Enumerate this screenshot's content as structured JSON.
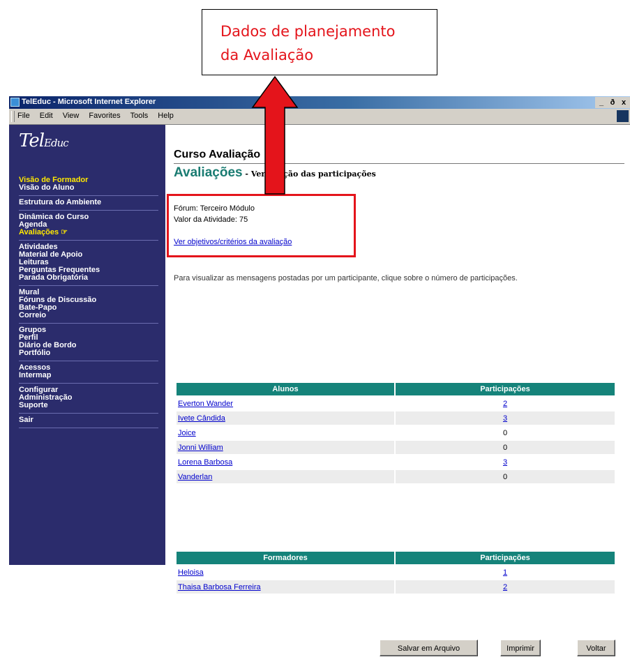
{
  "callout": {
    "line1": "Dados de planejamento",
    "line2": "da Avaliação"
  },
  "window": {
    "title": "TelEduc - Microsoft Internet Explorer",
    "controls": [
      "_",
      "ð",
      "x"
    ],
    "menu": [
      "File",
      "Edit",
      "View",
      "Favorites",
      "Tools",
      "Help"
    ]
  },
  "sidebar": {
    "logo_main": "Tel",
    "logo_sub": "Educ",
    "groups": [
      {
        "items": [
          {
            "label": "Visão de Formador",
            "highlight": true
          },
          {
            "label": "Visão do Aluno",
            "highlight": false
          }
        ]
      },
      {
        "items": [
          {
            "label": "Estrutura do Ambiente",
            "highlight": false
          }
        ]
      },
      {
        "items": [
          {
            "label": "Dinâmica do Curso",
            "highlight": false
          },
          {
            "label": "Agenda",
            "highlight": false
          },
          {
            "label": "Avaliações ☞",
            "highlight": true
          }
        ]
      },
      {
        "items": [
          {
            "label": "Atividades",
            "highlight": false
          },
          {
            "label": "Material de Apoio",
            "highlight": false
          },
          {
            "label": "Leituras",
            "highlight": false
          },
          {
            "label": "Perguntas Frequentes",
            "highlight": false
          },
          {
            "label": "Parada Obrigatória",
            "highlight": false
          }
        ]
      },
      {
        "items": [
          {
            "label": "Mural",
            "highlight": false
          },
          {
            "label": "Fóruns de Discussão",
            "highlight": false
          },
          {
            "label": "Bate-Papo",
            "highlight": false
          },
          {
            "label": "Correio",
            "highlight": false
          }
        ]
      },
      {
        "items": [
          {
            "label": "Grupos",
            "highlight": false
          },
          {
            "label": "Perfil",
            "highlight": false
          },
          {
            "label": "Diário de Bordo",
            "highlight": false
          },
          {
            "label": "Portfólio",
            "highlight": false
          }
        ]
      },
      {
        "items": [
          {
            "label": "Acessos",
            "highlight": false
          },
          {
            "label": "Intermap",
            "highlight": false
          }
        ]
      },
      {
        "items": [
          {
            "label": "Configurar",
            "highlight": false
          },
          {
            "label": "Administração",
            "highlight": false
          },
          {
            "label": "Suporte",
            "highlight": false
          }
        ]
      },
      {
        "items": [
          {
            "label": "Sair",
            "highlight": false
          }
        ]
      }
    ]
  },
  "main": {
    "course_title": "Curso Avaliação",
    "section_title": "Avaliações",
    "section_subtitle": " - Verificação das participações",
    "forum_line": "Fórum: Terceiro Módulo",
    "value_line": "Valor da Atividade: 75",
    "criteria_link": "Ver objetivos/critérios da avaliação",
    "instructions": "Para visualizar as mensagens postadas por um participante, clique sobre o número de participações.",
    "students_table": {
      "headers": [
        "Alunos",
        "Participações"
      ],
      "rows": [
        {
          "name": "Everton Wander",
          "count": "2",
          "link": true
        },
        {
          "name": "Ivete Cândida",
          "count": "3",
          "link": true
        },
        {
          "name": "Joice",
          "count": "0",
          "link": false
        },
        {
          "name": "Jonni William",
          "count": "0",
          "link": false
        },
        {
          "name": "Lorena Barbosa",
          "count": "3",
          "link": true
        },
        {
          "name": "Vanderlan",
          "count": "0",
          "link": false
        }
      ]
    },
    "trainers_table": {
      "headers": [
        "Formadores",
        "Participações"
      ],
      "rows": [
        {
          "name": "Heloisa",
          "count": "1",
          "link": true
        },
        {
          "name": "Thaisa Barbosa Ferreira",
          "count": "2",
          "link": true
        }
      ]
    },
    "buttons": {
      "save": "Salvar em Arquivo",
      "print": "Imprimir",
      "back": "Voltar"
    }
  },
  "colors": {
    "annotation_red": "#e4141b",
    "sidebar_bg": "#2b2c6c",
    "table_header": "#15837a",
    "link": "#0000cc"
  }
}
